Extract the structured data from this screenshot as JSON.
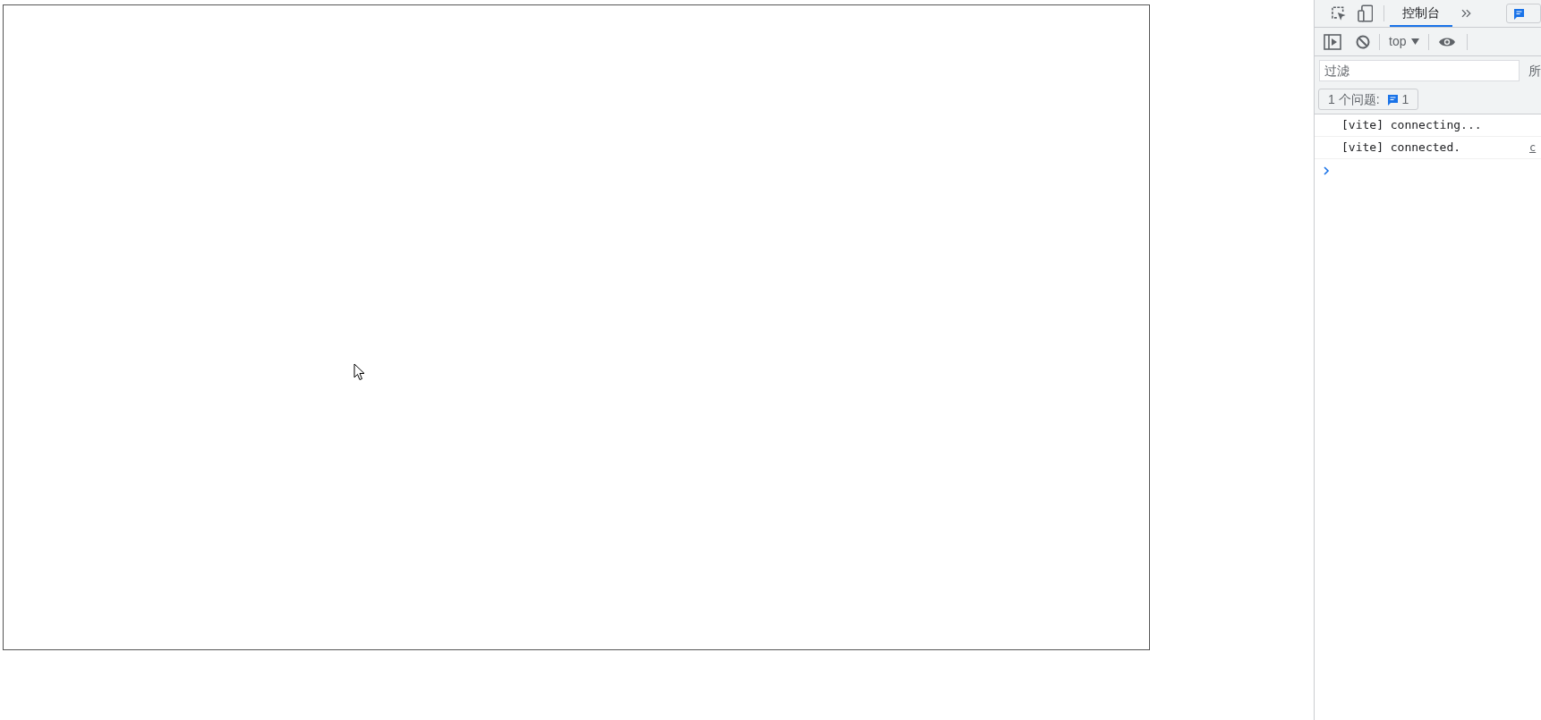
{
  "devtools": {
    "tabs": [
      {
        "label": "控制台",
        "selected": true
      }
    ],
    "context": "top",
    "filter": {
      "placeholder": "过滤"
    },
    "levels_label": "所",
    "issues": {
      "label": "1 个问题:",
      "count": "1"
    },
    "messages": [
      {
        "text": "[vite] connecting..."
      },
      {
        "text": "[vite] connected.",
        "source": "c"
      }
    ]
  }
}
